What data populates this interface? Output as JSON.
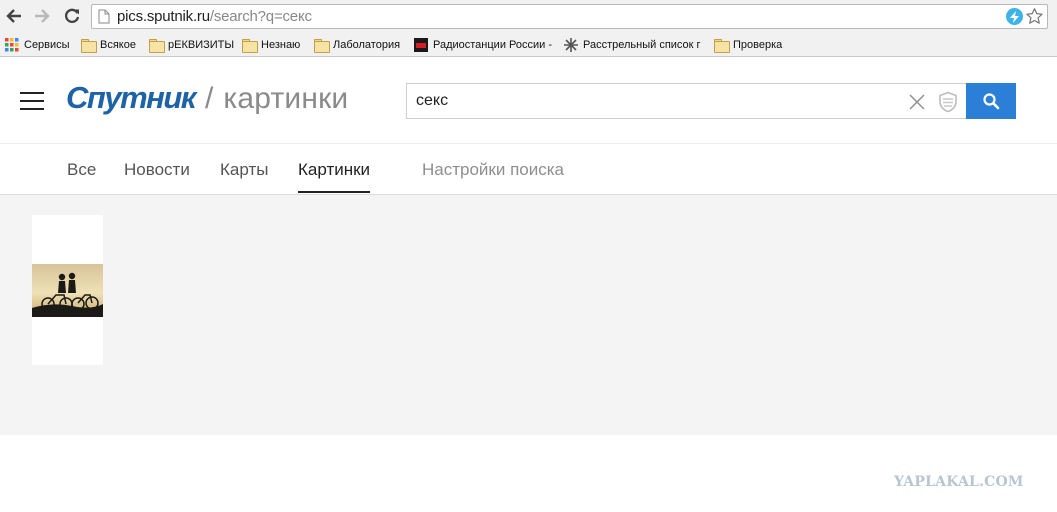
{
  "browser": {
    "url_host": "pics.sputnik.ru",
    "url_path": "/search?q=секс",
    "bookmarks": [
      {
        "label": "Сервисы",
        "icon": "apps-grid-icon"
      },
      {
        "label": "Всякое",
        "icon": "folder-icon"
      },
      {
        "label": "рЕКВИЗИТЫ",
        "icon": "folder-icon"
      },
      {
        "label": "Незнаю",
        "icon": "folder-icon"
      },
      {
        "label": "Лаболатория",
        "icon": "folder-icon"
      },
      {
        "label": "Радиостанции России -",
        "icon": "radio-favicon-icon"
      },
      {
        "label": "Расстрельный список г",
        "icon": "asterisk-favicon-icon"
      },
      {
        "label": "Проверка",
        "icon": "folder-icon"
      }
    ]
  },
  "header": {
    "logo_main": "Спутник",
    "logo_separator": "/",
    "logo_sub": "картинки",
    "search_value": "секс"
  },
  "tabs": [
    {
      "label": "Все",
      "active": false
    },
    {
      "label": "Новости",
      "active": false
    },
    {
      "label": "Карты",
      "active": false
    },
    {
      "label": "Картинки",
      "active": true
    },
    {
      "label": "Настройки поиска",
      "active": false
    }
  ],
  "colors": {
    "brand_blue": "#1e63a8",
    "search_button": "#2b7fd6",
    "results_background": "#f4f4f4"
  },
  "watermark": "YAPLAKAL.COM"
}
